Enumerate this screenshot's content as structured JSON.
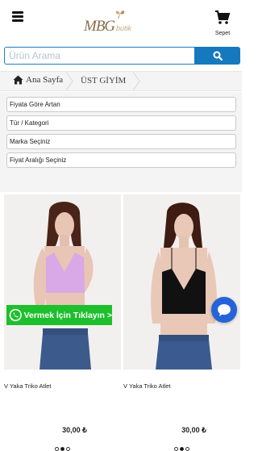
{
  "header": {
    "menu_icon": "hamburger-menu-icon",
    "logo_main": "MBG",
    "logo_sub": "butik",
    "cart_icon": "shopping-cart-icon",
    "cart_label": "Sepet"
  },
  "search": {
    "placeholder": "Ürün Arama",
    "button_icon": "search-icon",
    "border_color": "#1d7fc2",
    "button_color": "#1679be"
  },
  "breadcrumb": {
    "home_icon": "home-icon",
    "home_label": "Ana Sayfa",
    "current": "ÜST GİYİM"
  },
  "filters": [
    {
      "label": "Fiyata Göre Artan"
    },
    {
      "label": "Tür / Kategori"
    },
    {
      "label": "Marka Seçiniz"
    },
    {
      "label": "Fiyat Aralığı Seçiniz"
    }
  ],
  "products": [
    {
      "name": "V Yaka Triko Atlet",
      "price": "30,00 ₺",
      "top_color": "#d9a8e6",
      "active_dot": 1
    },
    {
      "name": "V Yaka Triko Atlet",
      "price": "30,00 ₺",
      "top_color": "#111111",
      "active_dot": 1
    }
  ],
  "whatsapp": {
    "icon": "whatsapp-icon",
    "label": "Vermek İçin Tıklayın >",
    "color": "#1dbf2d"
  },
  "chat": {
    "icon": "chat-bubble-icon",
    "color": "#2563d8"
  }
}
